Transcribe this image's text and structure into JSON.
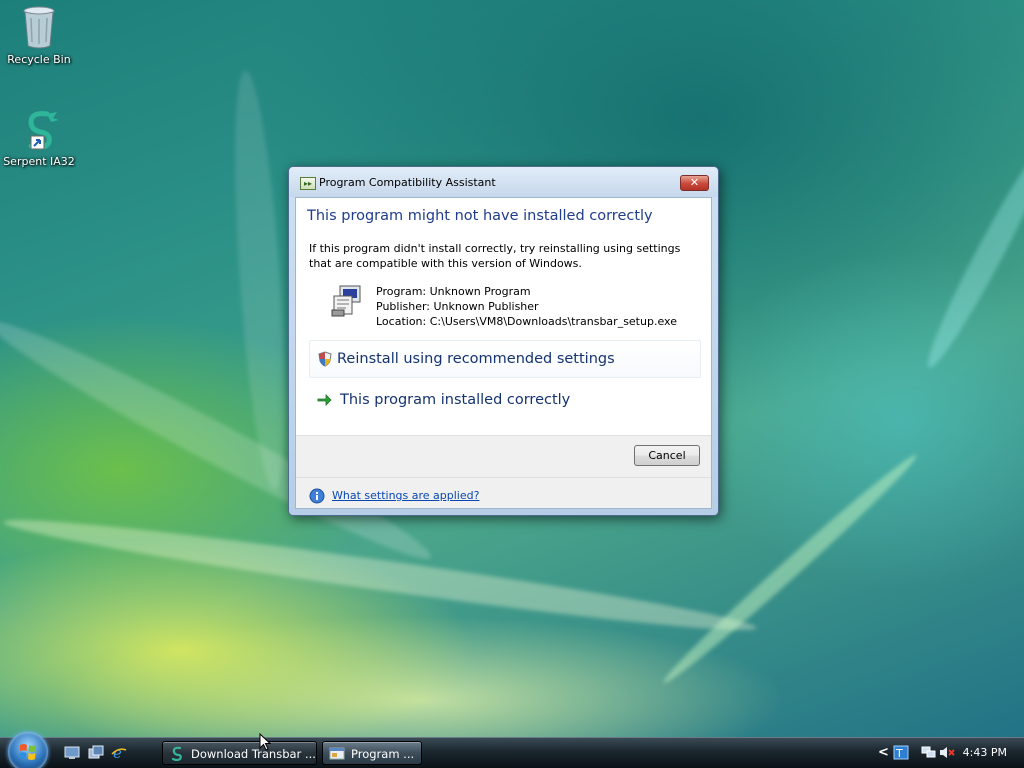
{
  "desktop": {
    "icons": [
      {
        "label": "Recycle Bin",
        "icon": "recycle-bin-icon"
      },
      {
        "label": "Serpent IA32",
        "icon": "serpent-shortcut-icon"
      }
    ]
  },
  "dialog": {
    "title": "Program Compatibility Assistant",
    "close_glyph": "✕",
    "main_instruction": "This program might not have installed correctly",
    "content": "If this program didn't install correctly, try reinstalling using settings that are compatible with this version of Windows.",
    "program_line": "Program: Unknown Program",
    "publisher_line": "Publisher: Unknown Publisher",
    "location_line": "Location: C:\\Users\\VM8\\Downloads\\transbar_setup.exe",
    "command_reinstall": "Reinstall using recommended settings",
    "command_installed_ok": "This program installed correctly",
    "cancel_label": "Cancel",
    "footer_link": "What settings are applied?"
  },
  "taskbar": {
    "quick_launch": [
      "show-desktop-icon",
      "switch-windows-icon",
      "internet-explorer-icon"
    ],
    "tasks": [
      {
        "label": "Download Transbar ...",
        "icon": "serpent-icon"
      },
      {
        "label": "Program ...",
        "icon": "program-window-icon"
      }
    ],
    "tray_chevron": "<",
    "clock": "4:43 PM"
  },
  "colors": {
    "instruction_blue": "#1f3d8a",
    "link_blue": "#0a48b0",
    "command_text": "#15336e"
  }
}
